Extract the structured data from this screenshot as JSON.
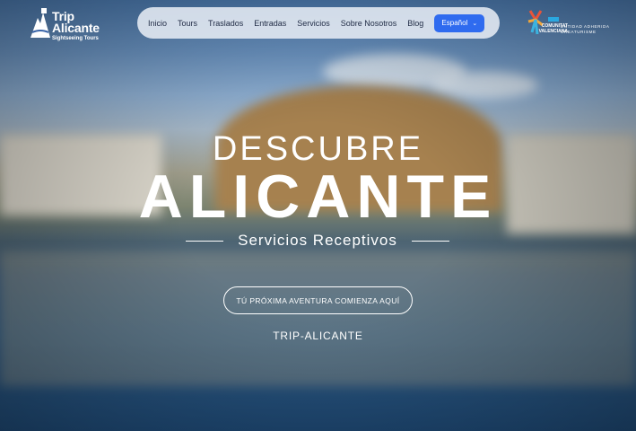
{
  "logo": {
    "title": "Trip\nAlicante",
    "subtitle": "Sightseeing Tours",
    "icon": "mountain-castle-icon"
  },
  "nav": {
    "items": [
      "Inicio",
      "Tours",
      "Traslados",
      "Entradas",
      "Servicios",
      "Sobre Nosotros",
      "Blog"
    ],
    "language": "Español"
  },
  "partner": {
    "line1": "COMUNITAT\nVALENCIANA",
    "line2": "ENTIDAD ADHERIDA\nCREATURISME"
  },
  "hero": {
    "kicker": "DESCUBRE",
    "title": "ALICANTE",
    "subtitle": "Servicios Receptivos",
    "cta": "TÚ PRÓXIMA AVENTURA COMIENZA AQUÍ",
    "brand": "TRIP-ALICANTE"
  },
  "colors": {
    "accent": "#2f6bef",
    "text": "#ffffff"
  }
}
